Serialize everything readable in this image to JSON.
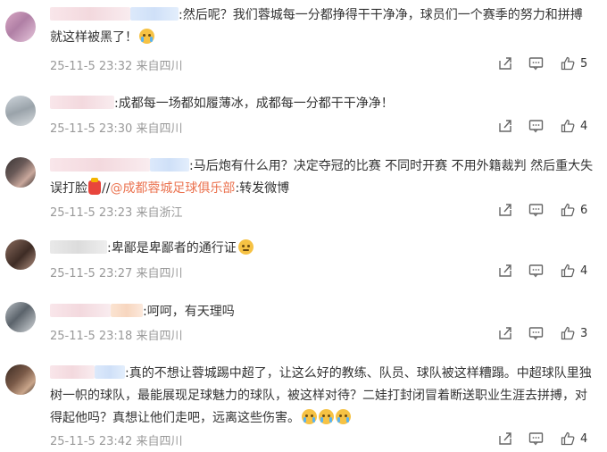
{
  "comments": [
    {
      "text": ":然后呢？我们蓉城每一分都挣得干干净净，球员们一个赛季的努力和拼搏就这样被黑了！",
      "meta": "25-11-5 23:32 来自四川",
      "likes": "5"
    },
    {
      "text": ":成都每一场都如履薄冰，成都每一分都干干净净！",
      "meta": "25-11-5 23:30 来自四川",
      "likes": "4"
    },
    {
      "text_a": ":马后炮有什么用？决定夺冠的比赛 不同时开赛 不用外籍裁判 然后重大失误打脸",
      "text_b": "//",
      "link": "@成都蓉城足球俱乐部",
      "text_c": ":转发微博",
      "meta": "25-11-5 23:23 来自浙江",
      "likes": "6"
    },
    {
      "text": ":卑鄙是卑鄙者的通行证",
      "meta": "25-11-5 23:27 来自四川",
      "likes": "4"
    },
    {
      "text": ":呵呵，有天理吗",
      "meta": "25-11-5 23:18 来自四川",
      "likes": "3"
    },
    {
      "text": ":真的不想让蓉城踢中超了，让这么好的教练、队员、球队被这样糟蹋。中超球队里独树一帜的球队，最能展现足球魅力的球队，被这样对待？二娃打封闭冒着断送职业生涯去拼搏，对得起他吗？真想让他们走吧，远离这些伤害。",
      "meta": "25-11-5 23:42 来自四川",
      "likes": "4"
    }
  ],
  "icons": {
    "share": "share-icon",
    "reply": "comment-icon",
    "like": "thumb-up-icon"
  },
  "colors": {
    "link": "#eb7350",
    "meta": "#999999",
    "text": "#333333"
  }
}
